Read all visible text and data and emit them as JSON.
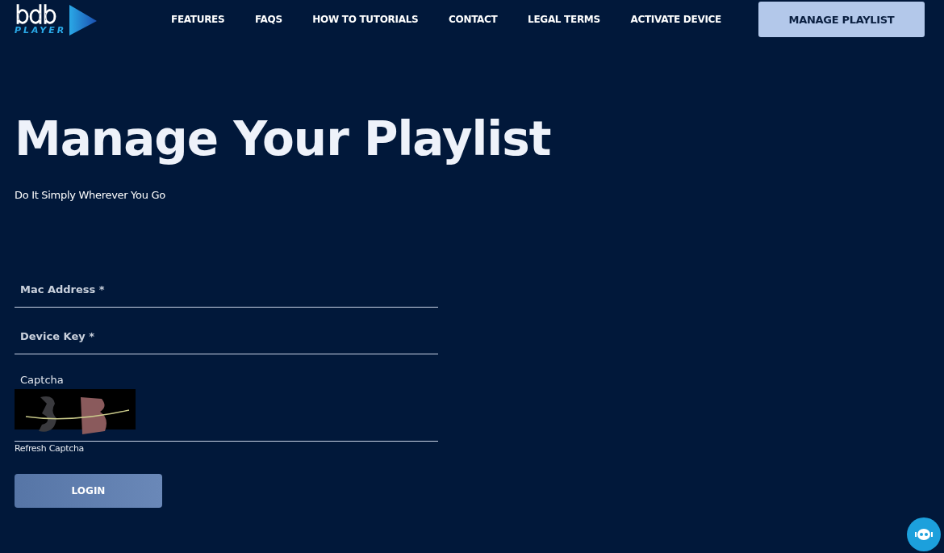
{
  "logo": {
    "mark": "bdb",
    "word": "PLAYER"
  },
  "nav": [
    "FEATURES",
    "FAQS",
    "HOW TO TUTORIALS",
    "CONTACT",
    "LEGAL TERMS",
    "ACTIVATE DEVICE"
  ],
  "cta": "MANAGE PLAYLIST",
  "title": "Manage Your Playlist",
  "subtitle": "Do It Simply Wherever You Go",
  "fields": [
    {
      "placeholder": "Mac Address *"
    },
    {
      "placeholder": "Device Key *"
    }
  ],
  "captcha": {
    "label": "Captcha",
    "kind": "picture",
    "refresh": "Refresh Captcha"
  },
  "login": "LOGIN"
}
